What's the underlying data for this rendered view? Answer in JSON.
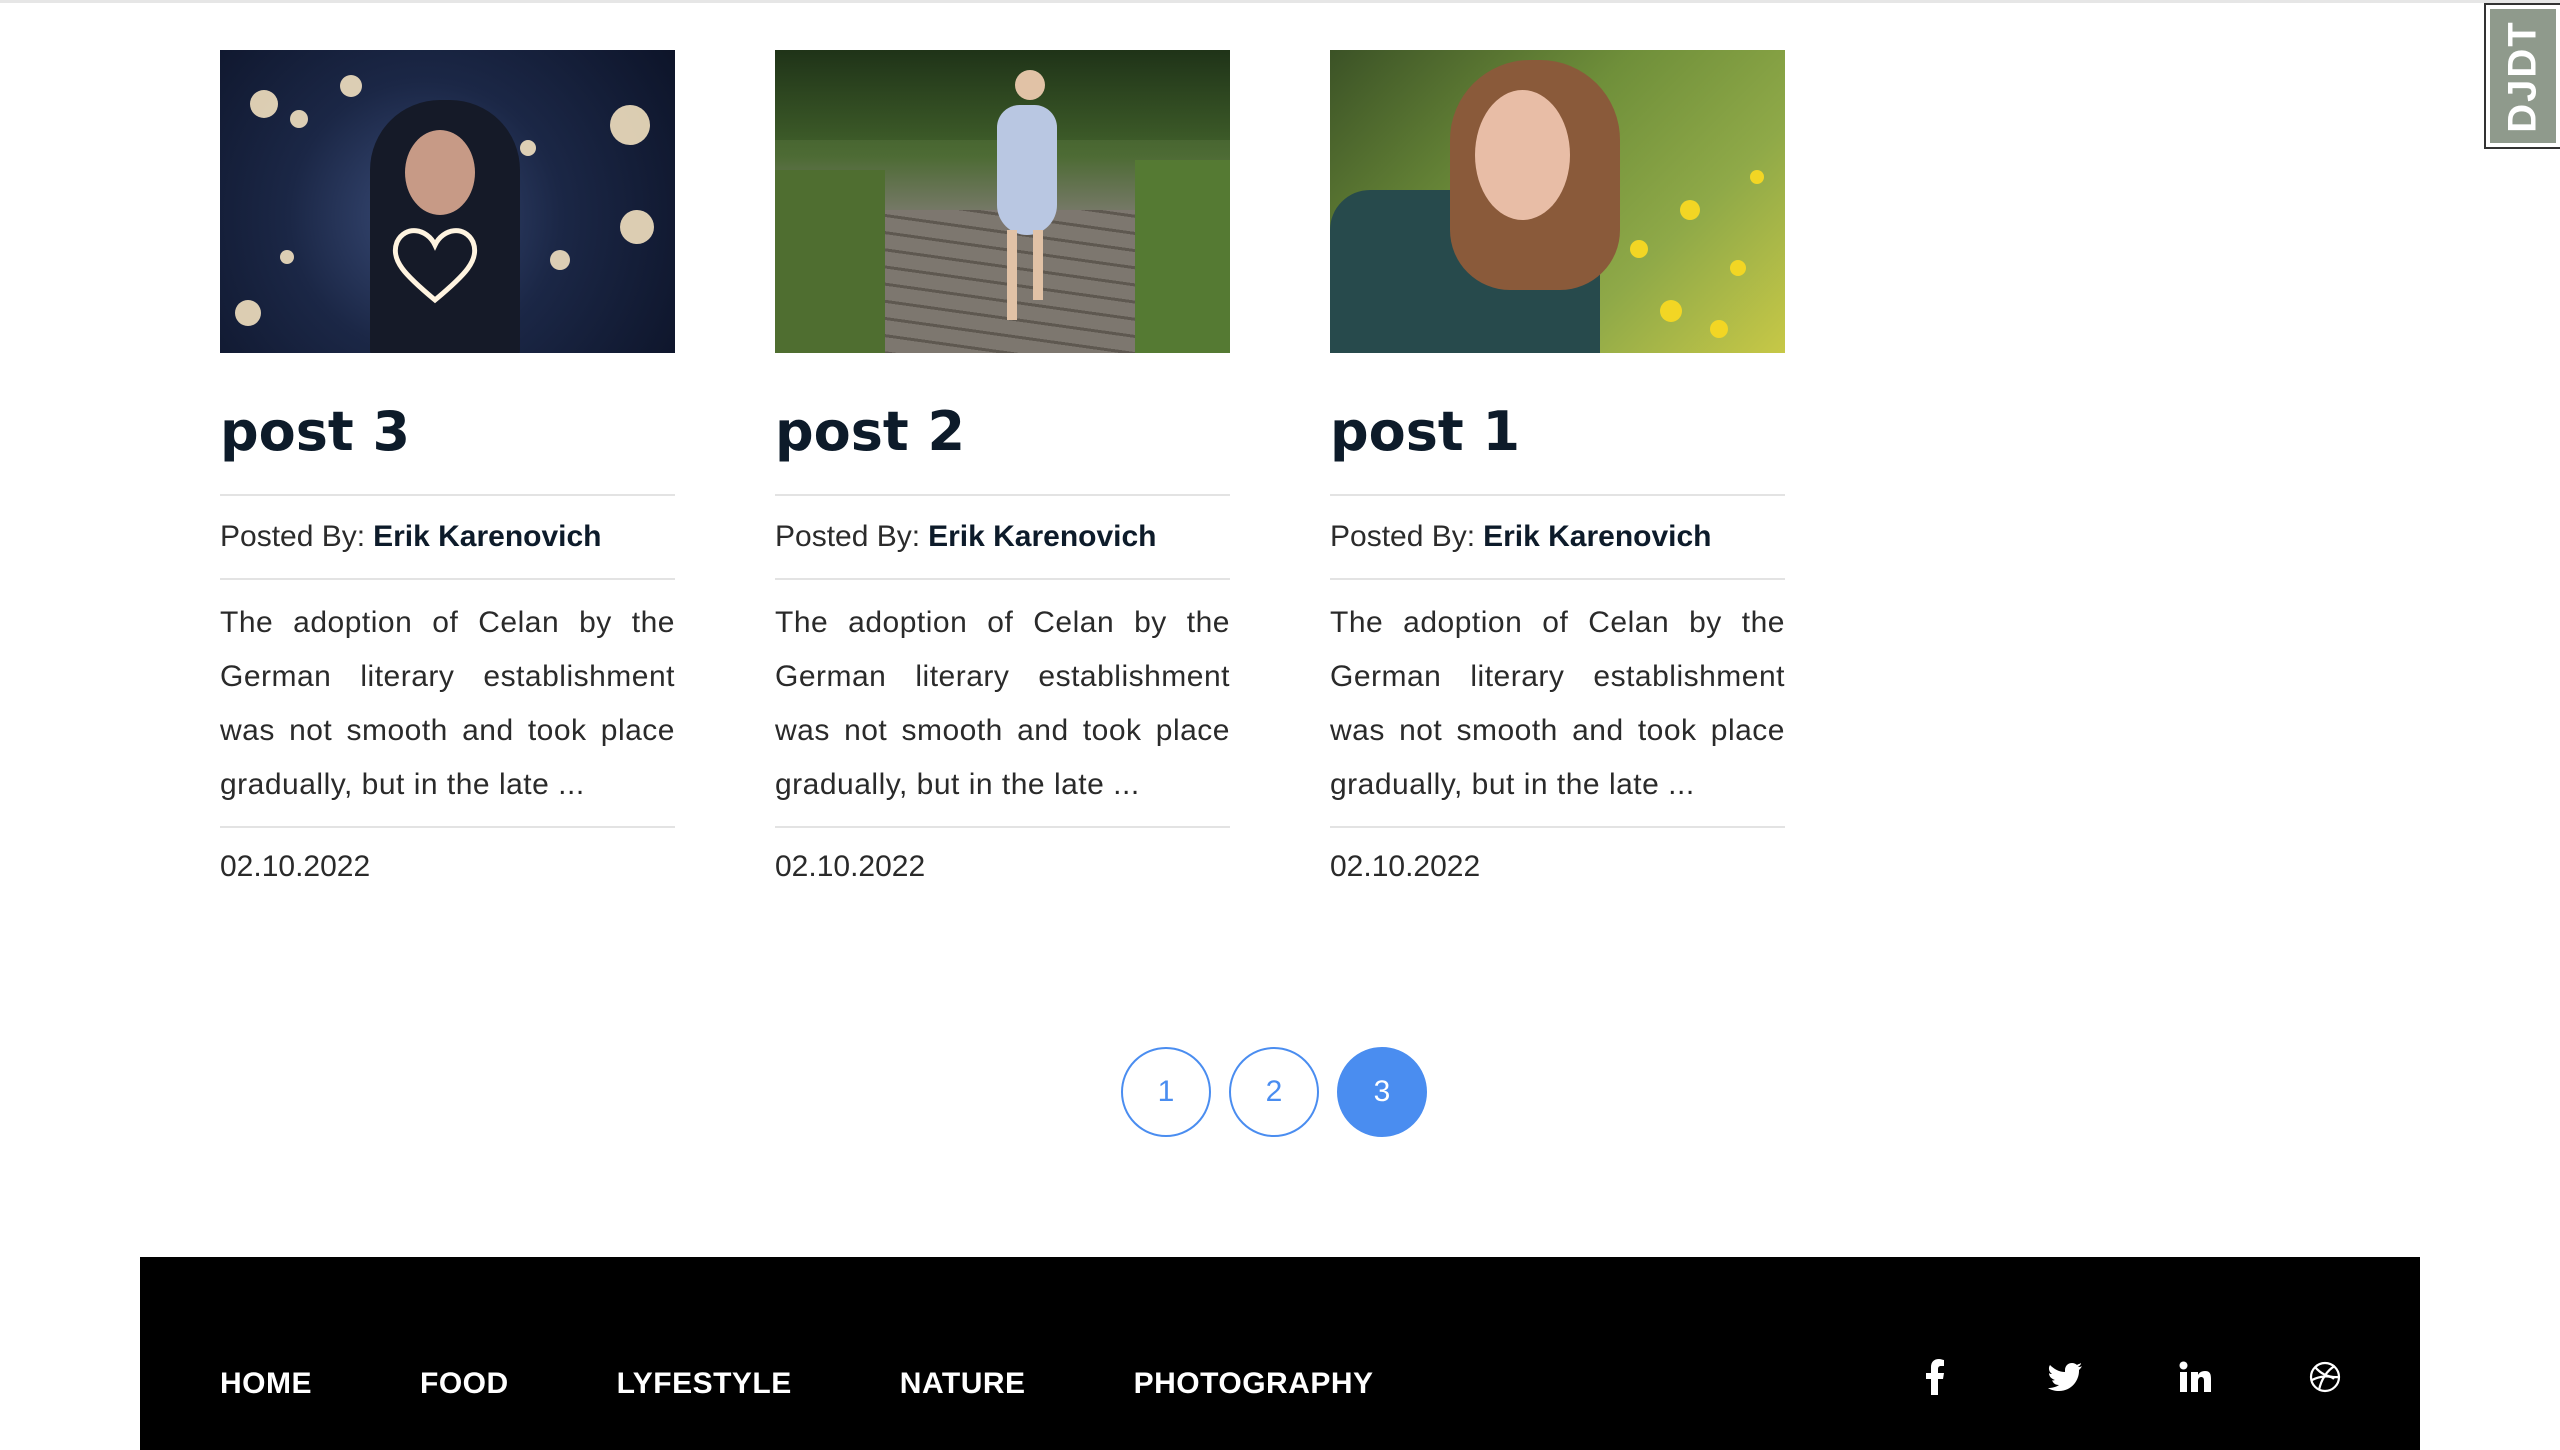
{
  "posts": [
    {
      "title": "post 3",
      "posted_by_label": "Posted By:",
      "author": "Erik Karenovich",
      "excerpt": "The adoption of Celan by the German literary establishment was not smooth and took place gradually, but in the late ...",
      "date": "02.10.2022"
    },
    {
      "title": "post 2",
      "posted_by_label": "Posted By:",
      "author": "Erik Karenovich",
      "excerpt": "The adoption of Celan by the German literary establishment was not smooth and took place gradually, but in the late ...",
      "date": "02.10.2022"
    },
    {
      "title": "post 1",
      "posted_by_label": "Posted By:",
      "author": "Erik Karenovich",
      "excerpt": "The adoption of Celan by the German literary establishment was not smooth and took place gradually, but in the late ...",
      "date": "02.10.2022"
    }
  ],
  "pagination": {
    "pages": [
      "1",
      "2",
      "3"
    ],
    "current": "3"
  },
  "footer": {
    "nav": [
      "HOME",
      "FOOD",
      "LYFESTYLE",
      "NATURE",
      "PHOTOGRAPHY"
    ],
    "social_icons": [
      "facebook-icon",
      "twitter-icon",
      "linkedin-icon",
      "dribbble-icon"
    ]
  },
  "debug_toolbar": {
    "label": "DJDT"
  },
  "colors": {
    "accent": "#4a8df0",
    "title": "#0d1b2a",
    "footer_bg": "#000000"
  }
}
